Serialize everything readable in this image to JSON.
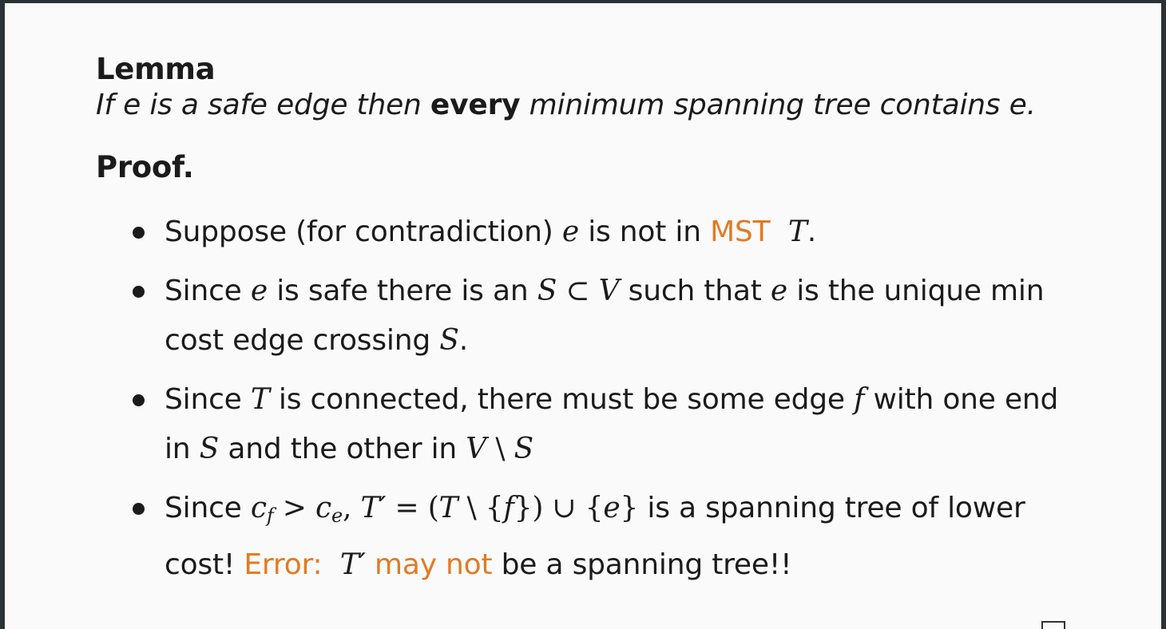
{
  "lemma": {
    "title": "Lemma",
    "statement_pre": "If e is a safe edge then ",
    "statement_bold": "every",
    "statement_post": " minimum spanning tree contains e."
  },
  "proof": {
    "title": "Proof.",
    "bullets": [
      {
        "t1": "Suppose (for contradiction) ",
        "e": "e",
        "t2": " is not in ",
        "mst": "MST",
        "T": "T",
        "t3": "."
      },
      {
        "t1": "Since ",
        "e1": "e",
        "t2": " is safe there is an ",
        "S": "S",
        "subset": " ⊂ ",
        "V": "V",
        "t3": " such that ",
        "e2": "e",
        "t4": " is the unique min cost edge crossing ",
        "S2": "S",
        "t5": "."
      },
      {
        "t1": "Since ",
        "T": "T",
        "t2": " is connected, there must be some edge ",
        "f": "f",
        "t3": " with one end in ",
        "S": "S",
        "t4": " and the other in ",
        "V": "V",
        "setminus": " \\ ",
        "S2": "S"
      },
      {
        "t1": "Since ",
        "c": "c",
        "f_sub": "f",
        "gt": " > ",
        "c2": "c",
        "e_sub": "e",
        "comma": ", ",
        "Tp": "T′",
        "eq": " = (",
        "T": "T",
        "sm": " \\ {",
        "f": "f",
        "union": "}) ∪ {",
        "e": "e",
        "close": "}",
        "t2": " is a spanning tree of lower cost! ",
        "error": "Error:",
        "Tp2": "T′",
        "maynot": "may not",
        "t3": " be a spanning tree!!"
      }
    ]
  }
}
